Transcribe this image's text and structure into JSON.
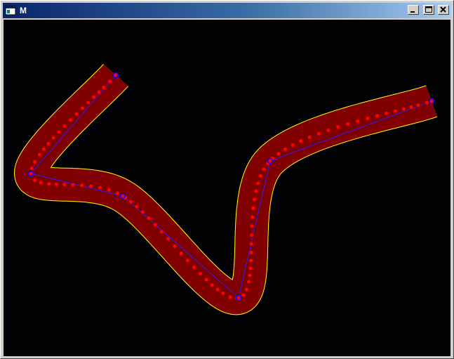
{
  "window": {
    "title": "M",
    "icon": "app-window-icon",
    "buttons": {
      "minimize": "minimize-icon",
      "maximize": "maximize-icon",
      "close": "close-icon"
    }
  },
  "canvas": {
    "background": "#020204",
    "band_color": "#800000",
    "band_outline_color": "#ffff00",
    "polyline_color": "#2020ff",
    "curve_point_color": "#ff0000",
    "control_point_color": "#0000ff"
  }
}
